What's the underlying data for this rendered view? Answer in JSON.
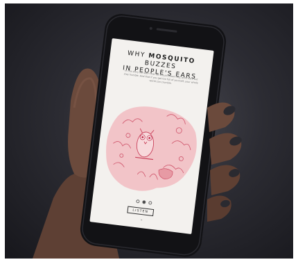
{
  "story": {
    "title_prefix": "WHY",
    "title_bold": "MOSQUITO",
    "title_line1_suffix": "BUZZES",
    "title_line2": "IN PEOPLE'S EARS",
    "intro": "In this story we learn that we should dream big, work hard but stay humble. And that if you get too full of yourself, your whole world can crumble.",
    "listen_label": "LISTEN",
    "pager": {
      "count": 3,
      "active": 1
    }
  },
  "colors": {
    "screen": "#f3f1ee",
    "illustration_fill": "#f2c4c8",
    "illustration_ink": "#c9405a",
    "skin": "#6b4a3c",
    "nail": "#2a2a30",
    "phone_body": "#121215"
  },
  "icons": [
    "chevron-down-icon"
  ]
}
